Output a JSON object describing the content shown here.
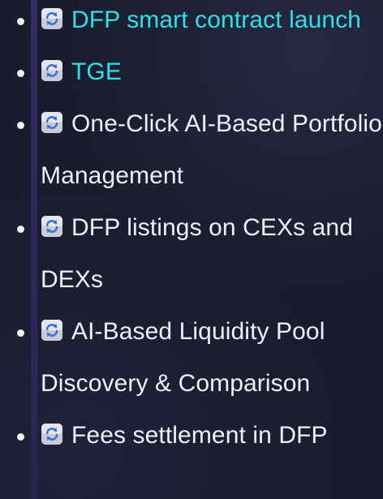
{
  "roadmap": {
    "items": [
      {
        "label": "DFP smart contract launch",
        "status": "done",
        "icon": "refresh-icon"
      },
      {
        "label": "TGE",
        "status": "done",
        "icon": "refresh-icon"
      },
      {
        "label": "One-Click AI-Based Portfolio Management",
        "status": "in-progress",
        "icon": "refresh-icon"
      },
      {
        "label": "DFP listings on CEXs and DEXs",
        "status": "in-progress",
        "icon": "refresh-icon"
      },
      {
        "label": "AI-Based Liquidity Pool Discovery & Comparison",
        "status": "in-progress",
        "icon": "refresh-icon"
      },
      {
        "label": "Fees settlement in DFP",
        "status": "in-progress",
        "icon": "refresh-icon"
      }
    ]
  },
  "colors": {
    "done_text": "#2fe0e6",
    "default_text": "#eef0f6",
    "background": "#1a1c2e"
  }
}
